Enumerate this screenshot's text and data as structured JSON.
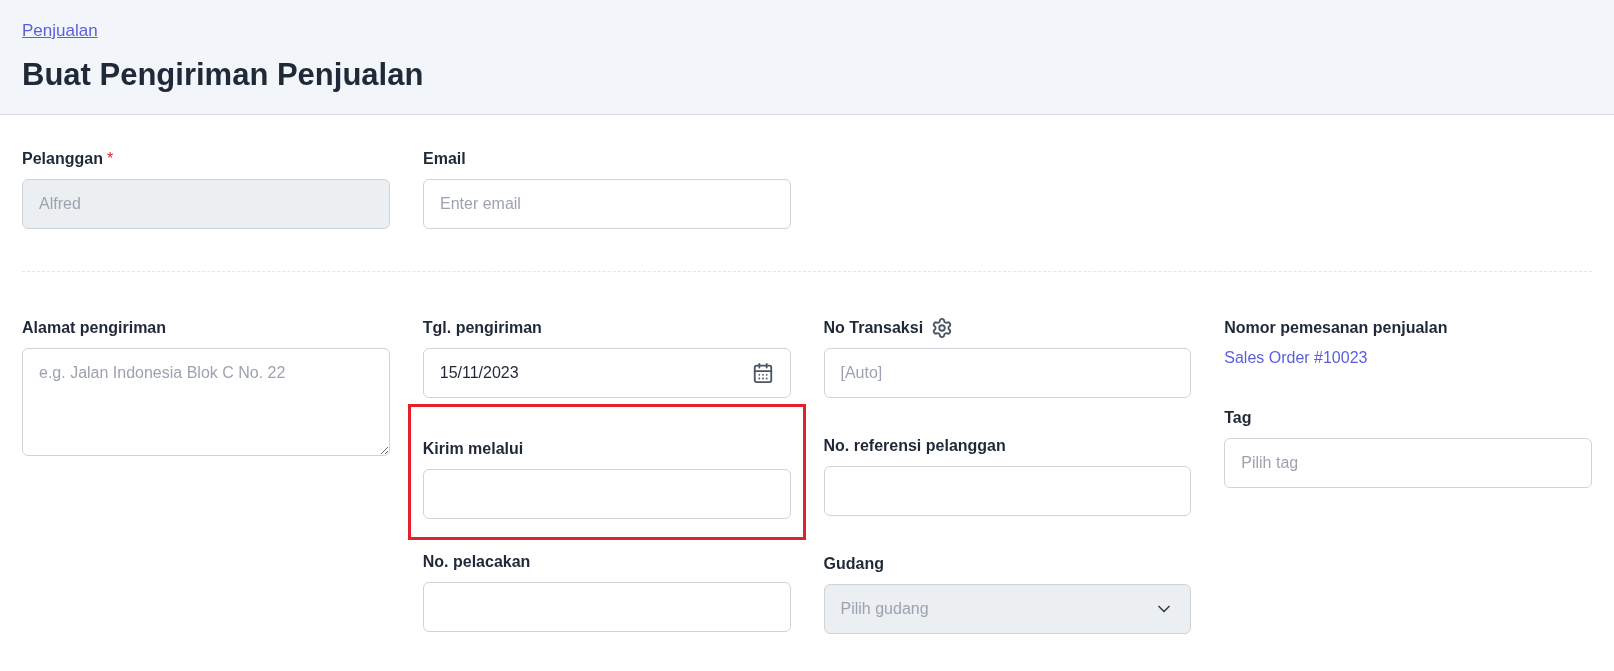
{
  "breadcrumb": "Penjualan",
  "title": "Buat Pengiriman Penjualan",
  "top_fields": [
    {
      "kind": "text",
      "label": "Pelanggan",
      "required_mark": "*",
      "value": "Alfred",
      "disabled": true
    },
    {
      "kind": "text",
      "label": "Email",
      "placeholder": "Enter email",
      "disabled": false
    }
  ],
  "columns": [
    [
      {
        "kind": "textarea",
        "label": "Alamat pengiriman",
        "placeholder": "e.g. Jalan Indonesia Blok C No. 22",
        "disabled": false,
        "highlighted": false
      }
    ],
    [
      {
        "kind": "date",
        "label": "Tgl. pengiriman",
        "value": "15/11/2023",
        "disabled": false,
        "highlighted": false
      },
      {
        "kind": "text",
        "label": "Kirim melalui",
        "disabled": false,
        "highlighted": true
      },
      {
        "kind": "text",
        "label": "No. pelacakan",
        "disabled": false,
        "highlighted": false
      }
    ],
    [
      {
        "kind": "text",
        "label": "No Transaksi",
        "settings": true,
        "placeholder": "[Auto]",
        "disabled": false,
        "highlighted": false
      },
      {
        "kind": "text",
        "label": "No. referensi pelanggan",
        "disabled": false,
        "highlighted": false
      },
      {
        "kind": "select",
        "label": "Gudang",
        "placeholder": "Pilih gudang",
        "disabled": true,
        "highlighted": false
      }
    ],
    [
      {
        "kind": "link",
        "label": "Nomor pemesanan penjualan",
        "value": "Sales Order #10023",
        "highlighted": false
      },
      {
        "kind": "text",
        "label": "Tag",
        "placeholder": "Pilih tag",
        "disabled": false,
        "highlighted": false
      }
    ]
  ]
}
